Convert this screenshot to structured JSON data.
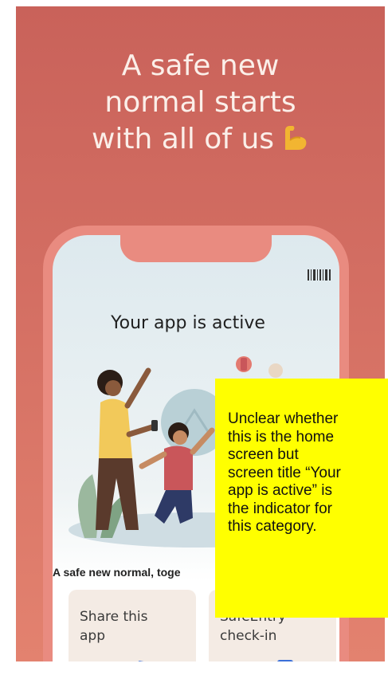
{
  "banner": {
    "headline_lines": [
      "A safe new",
      "normal starts",
      "with all of us"
    ],
    "emoji_icon": "flexed-biceps-icon",
    "colors": {
      "background": "#d06a5e",
      "headline_text": "#fbefe9",
      "phone_frame": "#e98b80"
    }
  },
  "app_screen": {
    "barcode_icon": "barcode-icon",
    "title": "Your app is active",
    "subtitle": "A safe new normal, toge",
    "cards": [
      {
        "label": "Share this\napp",
        "icon": "share-phones-icon"
      },
      {
        "label": "SafeEntry\ncheck-in",
        "icon": "phone-checkin-icon"
      }
    ]
  },
  "annotation": {
    "text": "Unclear whether\nthis is the home\nscreen but\nscreen title “Your\napp is active” is\nthe indicator for\nthis category.",
    "color": "#ffff00"
  }
}
